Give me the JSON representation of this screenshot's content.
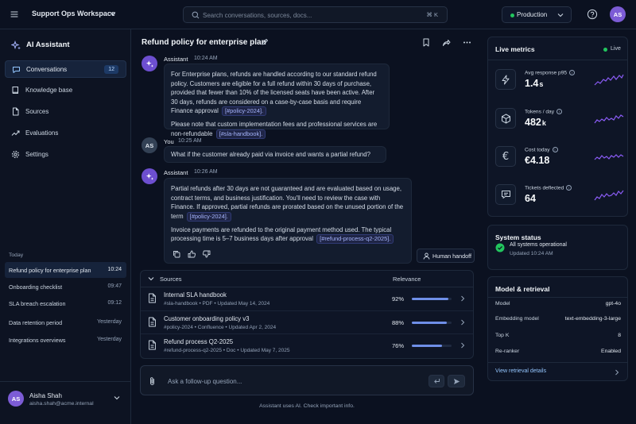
{
  "topbar": {
    "workspace": "Support Ops Workspace",
    "search_placeholder": "Search conversations, sources, docs...",
    "search_shortcut": "⌘ K",
    "environment": "Production",
    "avatar_initials": "AS"
  },
  "sidebar": {
    "brand": "AI Assistant",
    "nav": [
      {
        "label": "Conversations",
        "badge": "12",
        "icon": "chat-icon"
      },
      {
        "label": "Knowledge base",
        "icon": "book-icon"
      },
      {
        "label": "Sources",
        "icon": "file-icon"
      },
      {
        "label": "Evaluations",
        "icon": "trend-icon"
      },
      {
        "label": "Settings",
        "icon": "gear-icon"
      }
    ],
    "history_label": "Today",
    "history": [
      {
        "title": "Refund policy for enterprise plan",
        "time": "10:24"
      },
      {
        "title": "Onboarding checklist",
        "time": "09:47"
      },
      {
        "title": "SLA breach escalation",
        "time": "09:12"
      },
      {
        "title": "Data retention period",
        "time": "Yesterday"
      },
      {
        "title": "Integrations overviews",
        "time": "Yesterday"
      }
    ],
    "user": {
      "initials": "AS",
      "name": "Aisha Shah",
      "email": "aisha.shah@acme.internal"
    }
  },
  "conversation": {
    "title": "Refund policy for enterprise plan",
    "messages": [
      {
        "sender": "Assistant",
        "time": "10:24 AM",
        "p1": "For Enterprise plans, refunds are handled according to our standard refund policy. Customers are eligible for a full refund within 30 days of purchase, provided that fewer than 10% of the licensed seats have been active. After 30 days, refunds are considered on a case-by-case basis and require Finance approval",
        "p1_cite": "[#policy-2024].",
        "p2": "Please note that custom implementation fees and professional services are non-refundable",
        "p2_cite": "[#sla-handbook]."
      },
      {
        "sender": "You",
        "initials": "AS",
        "time": "10:25 AM",
        "text": "What if the customer already paid via invoice and wants a partial refund?"
      },
      {
        "sender": "Assistant",
        "time": "10:26 AM",
        "p1": "Partial refunds after 30 days are not guaranteed and are evaluated based on usage, contract terms, and business justification. You'll need to review the case with Finance. If approved, partial refunds are prorated based on the unused portion of the term",
        "p1_cite": "[#policy-2024].",
        "p2": "Invoice payments are refunded to the original payment method used. The typical processing time is 5–7 business days after approval",
        "p2_cite": "[#refund-process-q2-2025]."
      }
    ],
    "handoff_label": "Human handoff"
  },
  "sources": {
    "header": "Sources",
    "relevance_header": "Relevance",
    "rows": [
      {
        "title": "Internal SLA handbook",
        "meta": "#sla-handbook  •  PDF  •  Updated May 14, 2024",
        "relevance": "92%",
        "value": 0.92
      },
      {
        "title": "Customer onboarding policy v3",
        "meta": "#policy-2024  •  Confluence  •  Updated Apr 2, 2024",
        "relevance": "88%",
        "value": 0.88
      },
      {
        "title": "Refund process Q2-2025",
        "meta": "#refund-process-q2-2025  •  Doc  •  Updated May 7, 2025",
        "relevance": "76%",
        "value": 0.76
      }
    ]
  },
  "composer": {
    "placeholder": "Ask a follow-up question...",
    "disclaimer": "Assistant uses AI. Check important info."
  },
  "metrics": {
    "title": "Live metrics",
    "status": "Live",
    "items": [
      {
        "label": "Avg response p95",
        "value": "1.4",
        "unit": "s",
        "icon": "bolt-icon"
      },
      {
        "label": "Tokens / day",
        "value": "482",
        "unit": "k",
        "icon": "cube-icon"
      },
      {
        "label": "Cost today",
        "value": "€4.18",
        "unit": "",
        "icon": "euro-icon"
      },
      {
        "label": "Tickets deflected",
        "value": "64",
        "unit": "",
        "icon": "ticket-icon"
      }
    ]
  },
  "system_status": {
    "title": "System status",
    "label": "All systems operational",
    "updated": "Updated 10:24 AM"
  },
  "model": {
    "title": "Model & retrieval",
    "rows": [
      {
        "k": "Model",
        "v": "gpt-4o"
      },
      {
        "k": "Embedding model",
        "v": "text-embedding-3-large"
      },
      {
        "k": "Top K",
        "v": "8"
      },
      {
        "k": "Re-ranker",
        "v": "Enabled"
      }
    ],
    "link": "View retrieval details"
  },
  "colors": {
    "accent": "#7c5cd6",
    "success": "#22c55e",
    "bar": "#6f8fe8",
    "spark": "#8b5cf6"
  }
}
